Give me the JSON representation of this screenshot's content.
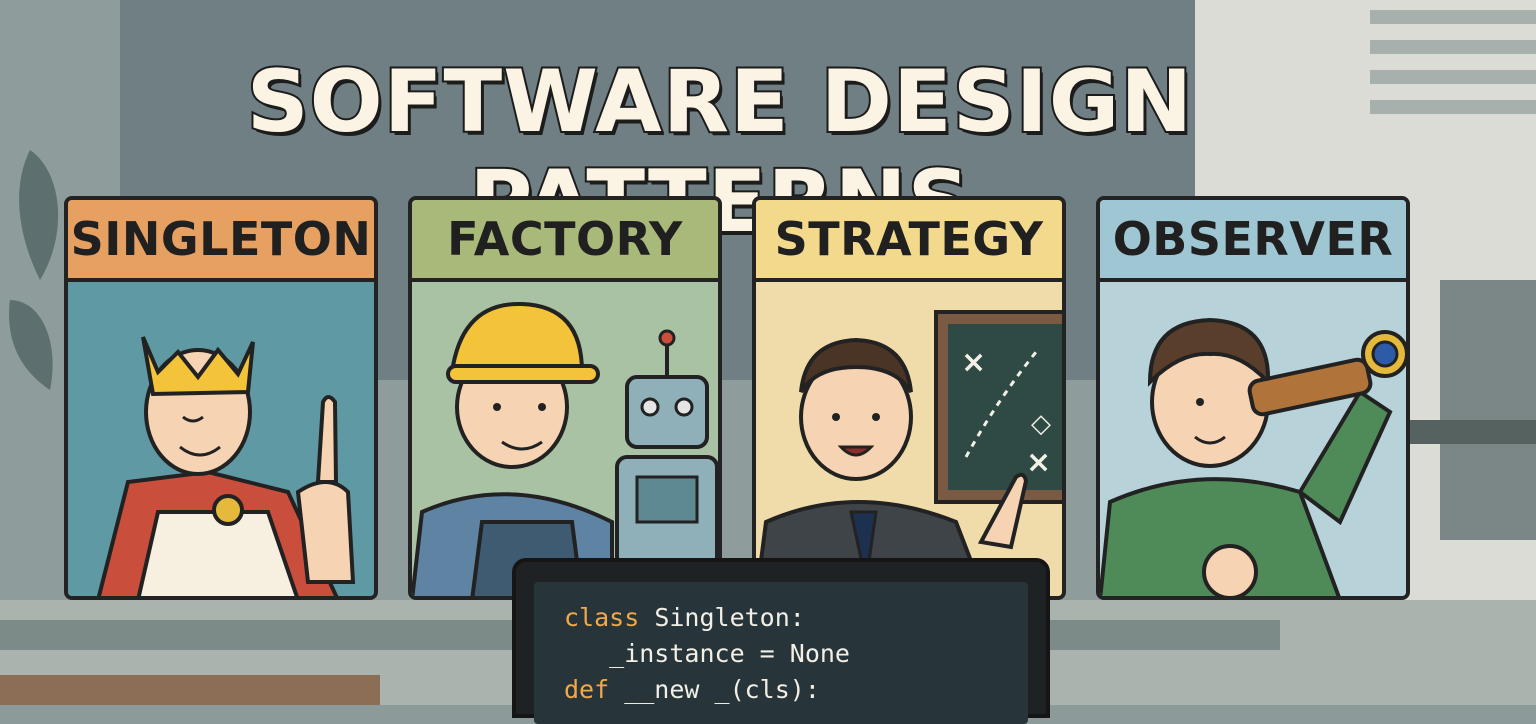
{
  "title": "SOFTWARE DESIGN PATTERNS",
  "cards": [
    {
      "label": "SINGLETON",
      "header_color": "#e6a062",
      "panel_color": "#5f9aa4",
      "figure": "king-with-crown-icon"
    },
    {
      "label": "FACTORY",
      "header_color": "#a8b97a",
      "panel_color": "#a9c2a4",
      "figure": "worker-with-robot-icon"
    },
    {
      "label": "STRATEGY",
      "header_color": "#f2d98c",
      "panel_color": "#efdcaa",
      "figure": "businessman-with-chalkboard-icon"
    },
    {
      "label": "OBSERVER",
      "header_color": "#9fc7d3",
      "panel_color": "#b7d2d9",
      "figure": "person-with-telescope-icon"
    }
  ],
  "laptop": {
    "code_lines": [
      {
        "kw": "class",
        "rest": " Singleton:"
      },
      {
        "kw": "",
        "rest": "   _instance = None"
      },
      {
        "kw": "def",
        "rest": " __new _(cls):"
      }
    ]
  }
}
